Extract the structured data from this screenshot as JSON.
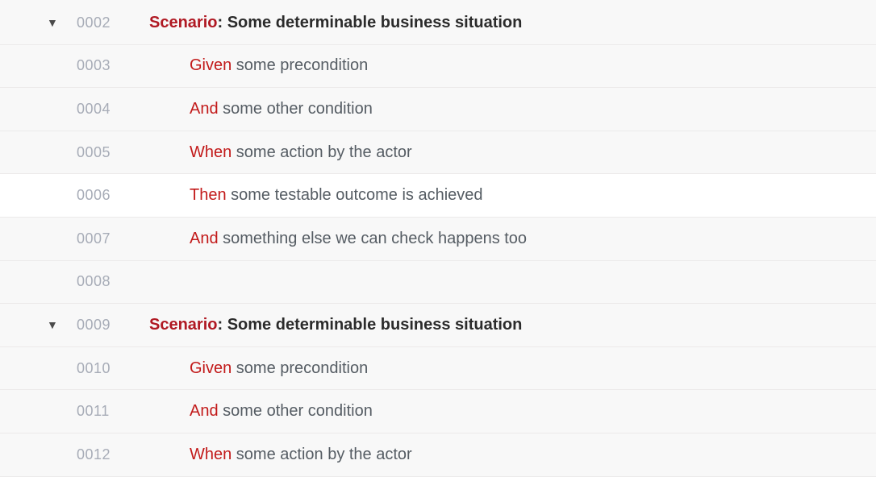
{
  "lines": [
    {
      "num": "0002",
      "fold": true,
      "type": "scenario",
      "keyword": "Scenario",
      "colon": ": ",
      "title": "Some determinable business situation"
    },
    {
      "num": "0003",
      "fold": false,
      "type": "step",
      "keyword": "Given",
      "text": " some precondition"
    },
    {
      "num": "0004",
      "fold": false,
      "type": "step",
      "keyword": "And",
      "text": " some other condition"
    },
    {
      "num": "0005",
      "fold": false,
      "type": "step",
      "keyword": "When",
      "text": " some action by the actor"
    },
    {
      "num": "0006",
      "fold": false,
      "type": "step",
      "keyword": "Then",
      "text": " some testable outcome is achieved",
      "active": true
    },
    {
      "num": "0007",
      "fold": false,
      "type": "step",
      "keyword": "And",
      "text": " something else we can check happens too"
    },
    {
      "num": "0008",
      "fold": false,
      "type": "blank"
    },
    {
      "num": "0009",
      "fold": true,
      "type": "scenario",
      "keyword": "Scenario",
      "colon": ": ",
      "title": "Some determinable business situation"
    },
    {
      "num": "0010",
      "fold": false,
      "type": "step",
      "keyword": "Given",
      "text": " some precondition"
    },
    {
      "num": "0011",
      "fold": false,
      "type": "step",
      "keyword": "And",
      "text": " some other condition"
    },
    {
      "num": "0012",
      "fold": false,
      "type": "step",
      "keyword": "When",
      "text": " some action by the actor"
    }
  ]
}
